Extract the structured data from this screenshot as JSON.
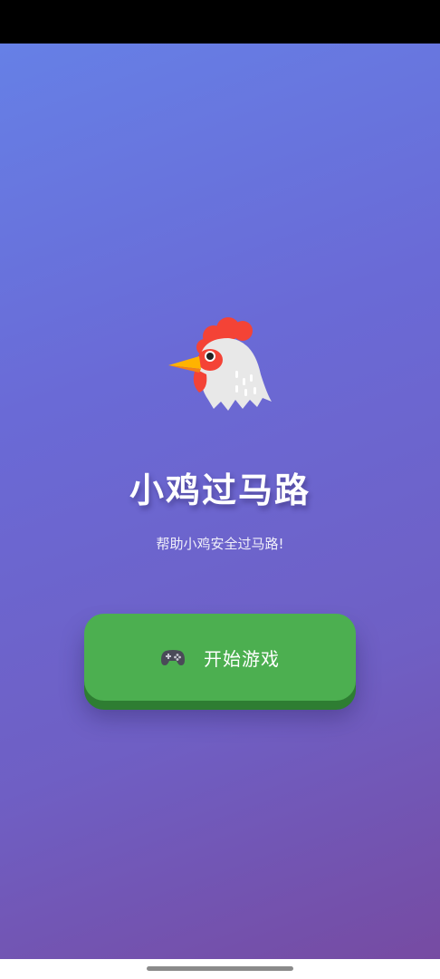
{
  "app": {
    "title": "小鸡过马路",
    "subtitle": "帮助小鸡安全过马路!",
    "mascot_icon": "rooster-icon"
  },
  "start_button": {
    "icon": "gamepad-icon",
    "label": "开始游戏"
  },
  "colors": {
    "background_gradient_start": "#6680e6",
    "background_gradient_end": "#764ba2",
    "button_green": "#4caf50",
    "button_shadow_green": "#2e7d32",
    "title_text": "#ffffff"
  }
}
